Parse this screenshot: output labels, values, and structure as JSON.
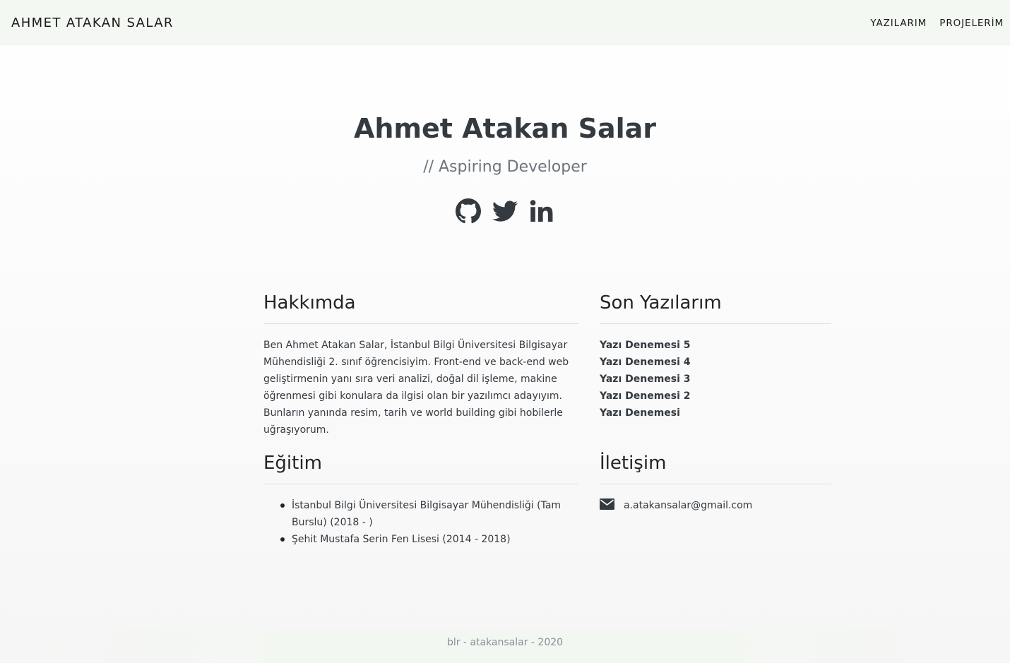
{
  "nav": {
    "brand": "AHMET ATAKAN SALAR",
    "links": [
      "YAZILARIM",
      "PROJELERİM"
    ]
  },
  "hero": {
    "title": "Ahmet Atakan Salar",
    "subtitle": "// Aspiring Developer",
    "social_icons": [
      "github-icon",
      "twitter-icon",
      "linkedin-icon"
    ]
  },
  "about": {
    "title": "Hakkımda",
    "text": "Ben Ahmet Atakan Salar, İstanbul Bilgi Üniversitesi Bilgisayar Mühendisliği 2. sınıf öğrencisiyim. Front-end ve back-end web geliştirmenin yanı sıra veri analizi, doğal dil işleme, makine öğrenmesi gibi konulara da ilgisi olan bir yazılımcı adayıyım. Bunların yanında resim, tarih ve world building gibi hobilerle uğraşıyorum."
  },
  "education": {
    "title": "Eğitim",
    "items": [
      "İstanbul Bilgi Üniversitesi Bilgisayar Mühendisliği (Tam Burslu) (2018 - )",
      "Şehit Mustafa Serin Fen Lisesi (2014 - 2018)"
    ]
  },
  "posts": {
    "title": "Son Yazılarım",
    "items": [
      "Yazı Denemesi 5",
      "Yazı Denemesi 4",
      "Yazı Denemesi 3",
      "Yazı Denemesi 2",
      "Yazı Denemesi"
    ]
  },
  "contact": {
    "title": "İletişim",
    "icon": "envelope-icon",
    "email": "a.atakansalar@gmail.com"
  },
  "footer": {
    "text": "blr - atakansalar - 2020"
  },
  "colors": {
    "navbar_bg": "#f4f8f3",
    "text": "#343a40",
    "muted": "#6c757d"
  }
}
